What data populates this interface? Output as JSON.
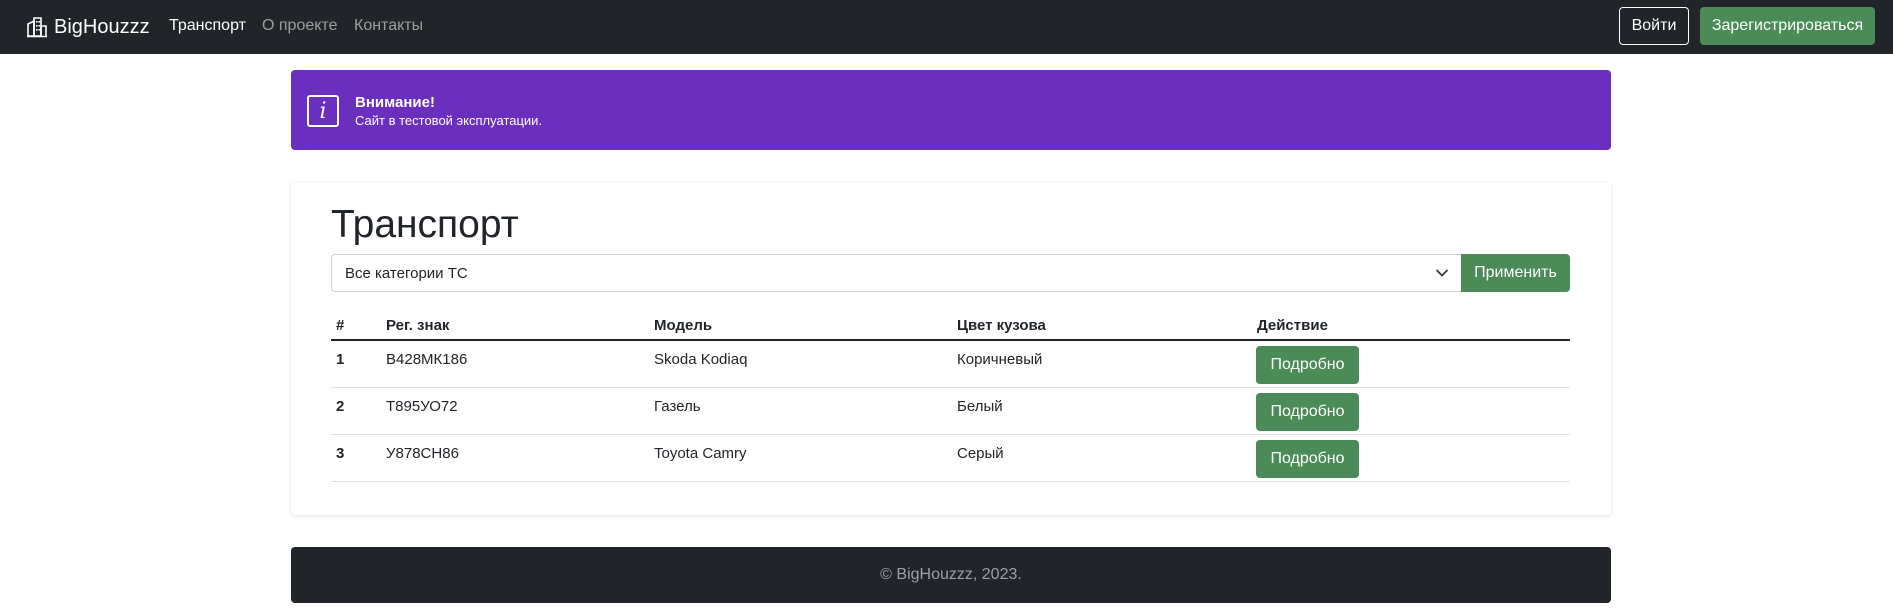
{
  "navbar": {
    "brand": "BigHouzzz",
    "links": [
      {
        "label": "Транспорт",
        "active": true
      },
      {
        "label": "О проекте",
        "active": false
      },
      {
        "label": "Контакты",
        "active": false
      }
    ],
    "login_label": "Войти",
    "register_label": "Зарегистрироваться"
  },
  "alert": {
    "icon": "info-icon",
    "title": "Внимание!",
    "text": "Сайт в тестовой эксплуатации."
  },
  "main": {
    "title": "Транспорт",
    "filter": {
      "selected": "Все категории ТС",
      "apply_label": "Применить"
    },
    "table": {
      "headers": [
        "#",
        "Рег. знак",
        "Модель",
        "Цвет кузова",
        "Действие"
      ],
      "rows": [
        {
          "num": "1",
          "plate": "В428МК186",
          "model": "Skoda Kodiaq",
          "color": "Коричневый",
          "action": "Подробно"
        },
        {
          "num": "2",
          "plate": "Т895УО72",
          "model": "Газель",
          "color": "Белый",
          "action": "Подробно"
        },
        {
          "num": "3",
          "plate": "У878СН86",
          "model": "Toyota Camry",
          "color": "Серый",
          "action": "Подробно"
        }
      ]
    }
  },
  "footer": {
    "text": "© BigHouzzz, 2023."
  },
  "colors": {
    "navbar": "#212529",
    "accent_green": "#4a8b57",
    "alert_purple": "#6a2fbf"
  }
}
